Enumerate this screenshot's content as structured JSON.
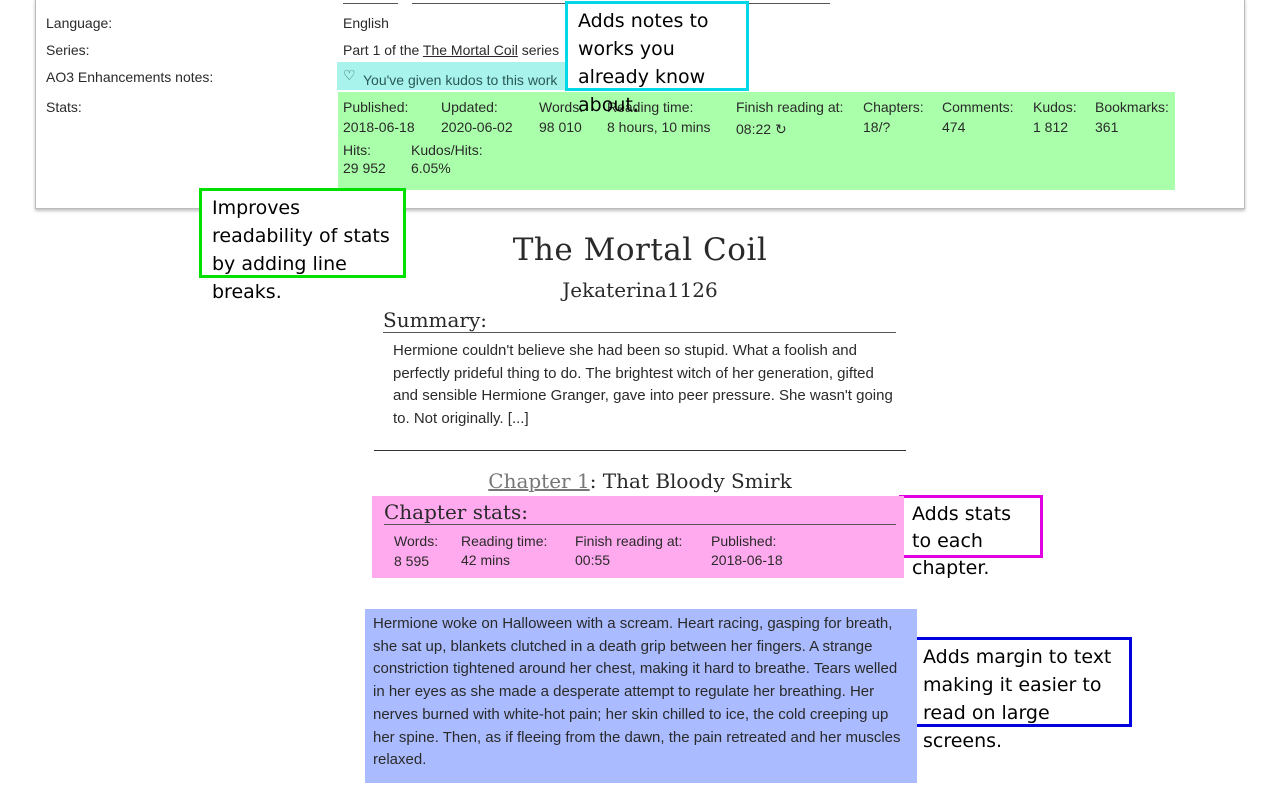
{
  "meta": {
    "language": {
      "label": "Language:",
      "value": "English"
    },
    "series": {
      "label": "Series:",
      "prefix": "Part 1 of the",
      "link": "The Mortal Coil",
      "suffix": "series"
    },
    "notes": {
      "label": "AO3 Enhancements notes:",
      "kudos_text": "You've given kudos to this work",
      "icon": "heart-icon"
    },
    "stats": {
      "label": "Stats:",
      "items": [
        {
          "label": "Published:",
          "value": "2018-06-18"
        },
        {
          "label": "Updated:",
          "value": "2020-06-02"
        },
        {
          "label": "Words:",
          "value": "98 010"
        },
        {
          "label": "Reading time:",
          "value": "8 hours, 10 mins"
        },
        {
          "label": "Finish reading at:",
          "value": "08:22",
          "icon": "refresh-icon"
        },
        {
          "label": "Chapters:",
          "value": "18/?"
        },
        {
          "label": "Comments:",
          "value": "474"
        },
        {
          "label": "Kudos:",
          "value": "1 812"
        },
        {
          "label": "Bookmarks:",
          "value": "361"
        },
        {
          "label": "Hits:",
          "value": "29 952"
        },
        {
          "label": "Kudos/Hits:",
          "value": "6.05%"
        }
      ]
    }
  },
  "callouts": {
    "notes": "Adds notes to works you already know about.",
    "stats": "Improves readability of stats by adding line breaks.",
    "chapter_stats": "Adds stats to each chapter.",
    "margin": "Adds margin to text making it easier to read on large screens."
  },
  "work": {
    "title": "The Mortal Coil",
    "author": "Jekaterina1126",
    "summary_heading": "Summary:",
    "summary": "Hermione couldn't believe she had been so stupid. What a foolish and perfectly prideful thing to do. The brightest witch of her generation, gifted and sensible Hermione Granger, gave into peer pressure. She wasn't going to. Not originally. [...]"
  },
  "chapter": {
    "link": "Chapter 1",
    "title": ": That Bloody Smirk",
    "stats_heading": "Chapter stats:",
    "stats": [
      {
        "label": "Words:",
        "value": "8 595"
      },
      {
        "label": "Reading time:",
        "value": "42 mins"
      },
      {
        "label": "Finish reading at:",
        "value": "00:55"
      },
      {
        "label": "Published:",
        "value": "2018-06-18"
      }
    ],
    "body": "Hermione woke on Halloween with a scream. Heart racing, gasping for breath, she sat up, blankets clutched in a death grip between her fingers. A strange constriction tightened around her chest, making it hard to breathe. Tears welled in her eyes as she made a desperate attempt to regulate her breathing. Her nerves burned with white-hot pain; her skin chilled to ice, the cold creeping up her spine. Then, as if fleeing from the dawn, the pain retreated and her muscles relaxed."
  },
  "colors": {
    "notes_callout": "#00d8e8",
    "stats_callout": "#00e000",
    "chapter_callout": "#e000e0",
    "margin_callout": "#0000e0"
  }
}
